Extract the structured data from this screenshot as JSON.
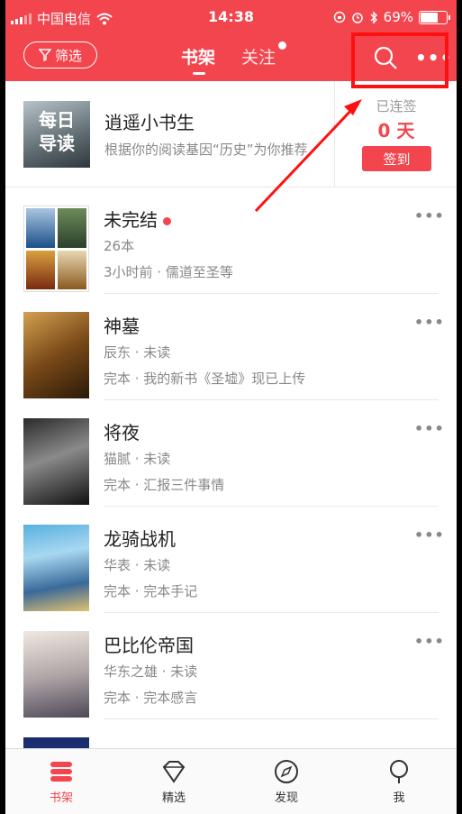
{
  "status_bar": {
    "carrier": "中国电信",
    "time": "14:38",
    "battery": "69%",
    "battery_level": 0.69
  },
  "header": {
    "filter_label": "筛选",
    "tabs": [
      {
        "label": "书架",
        "active": true
      },
      {
        "label": "关注",
        "active": false,
        "has_dot": true
      }
    ],
    "search_icon": "search-icon",
    "more_icon": "more-icon",
    "accent_color": "#f3454e"
  },
  "daily": {
    "cover_text": "每日 导读",
    "title": "逍遥小书生",
    "subtitle": "根据你的阅读基因“历史”为你推荐"
  },
  "checkin": {
    "label": "已连签",
    "days": "0 天",
    "button": "签到"
  },
  "books": [
    {
      "title": "未完结",
      "line1": "26本",
      "line2": "3小时前 · 儒道至圣等",
      "has_dot": true
    },
    {
      "title": "神墓",
      "line1": "辰东 · 未读",
      "line2": "完本 · 我的新书《圣墟》现已上传"
    },
    {
      "title": "将夜",
      "line1": "猫腻 · 未读",
      "line2": "完本 · 汇报三件事情"
    },
    {
      "title": "龙骑战机",
      "line1": "华表 · 未读",
      "line2": "完本 · 完本手记"
    },
    {
      "title": "巴比伦帝国",
      "line1": "华东之雄 · 未读",
      "line2": "完本 · 完本感言"
    }
  ],
  "bottom_nav": [
    {
      "label": "书架",
      "icon": "bookshelf-icon",
      "active": true
    },
    {
      "label": "精选",
      "icon": "diamond-icon",
      "active": false
    },
    {
      "label": "发现",
      "icon": "compass-icon",
      "active": false
    },
    {
      "label": "我",
      "icon": "profile-icon",
      "active": false
    }
  ]
}
